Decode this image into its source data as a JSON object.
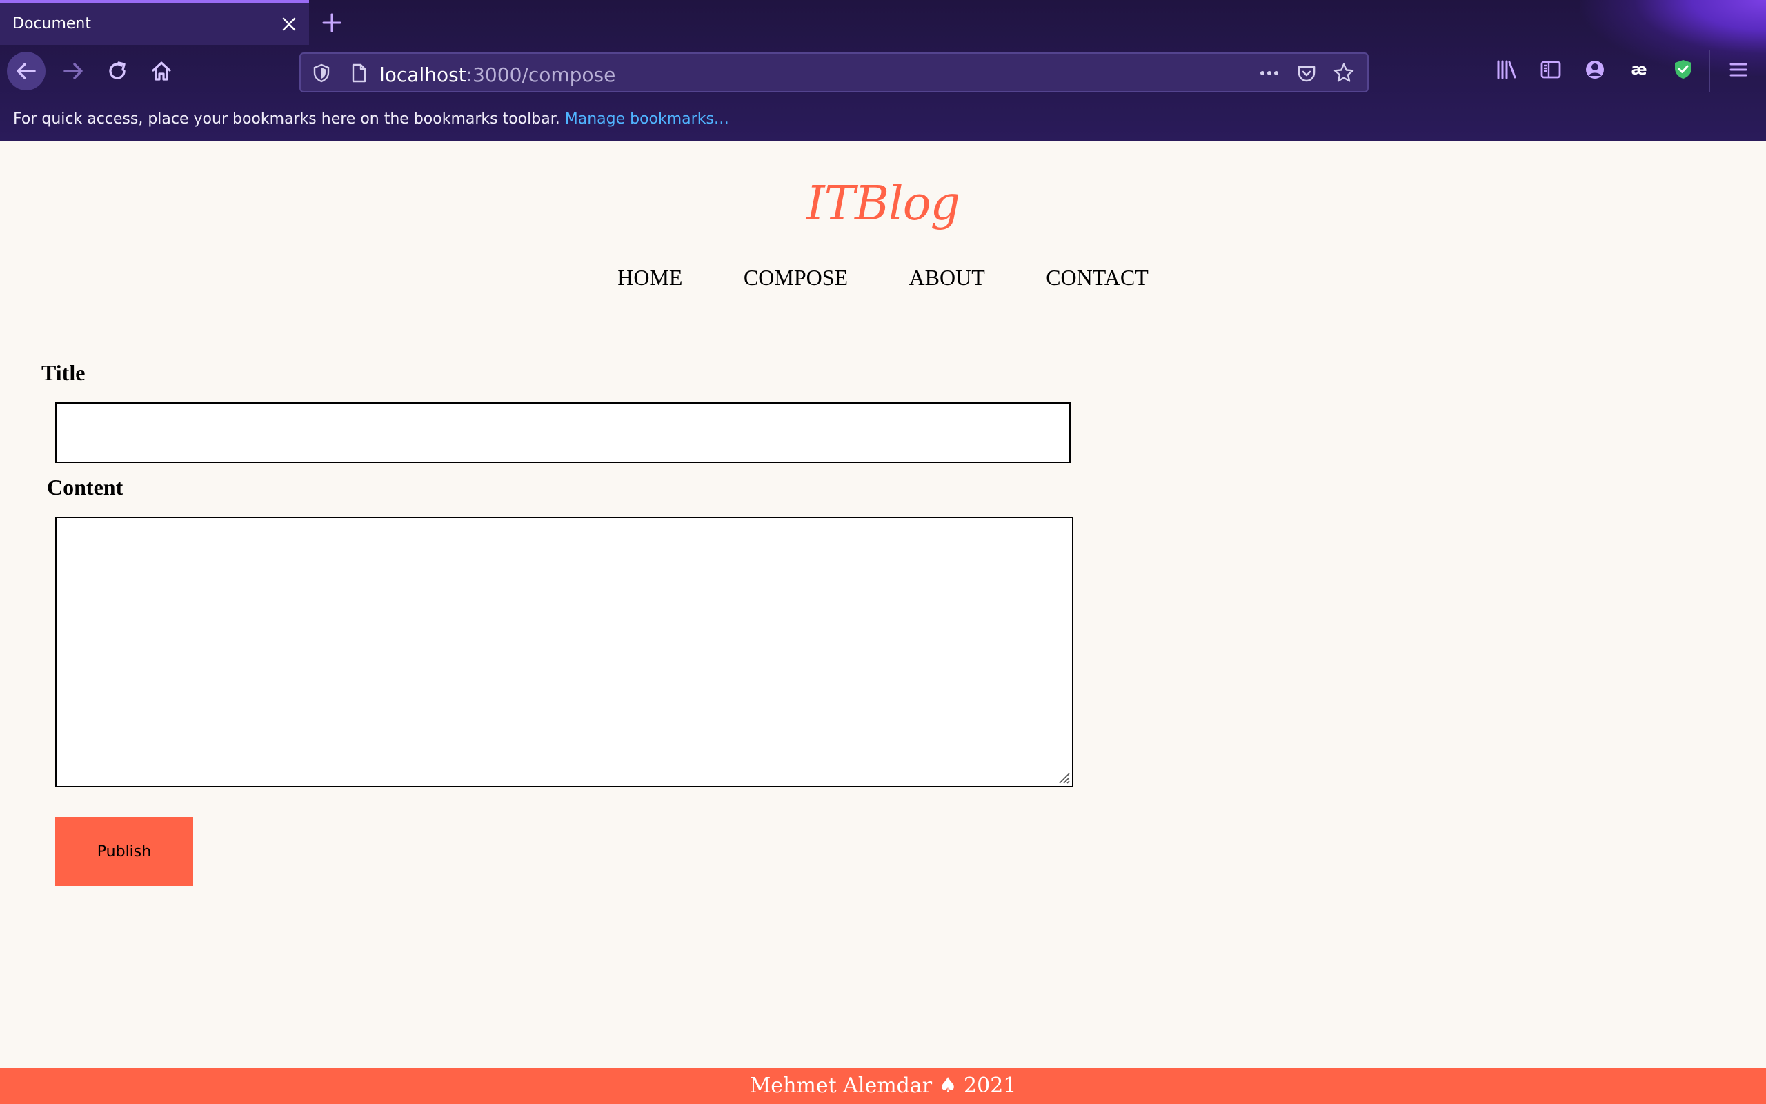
{
  "browser": {
    "tab_title": "Document",
    "url_host": "localhost",
    "url_path": ":3000/compose",
    "bookmarks_text": "For quick access, place your bookmarks here on the bookmarks toolbar.",
    "bookmarks_link": "Manage bookmarks…",
    "icons": [
      "close-icon",
      "plus-icon",
      "back-arrow-icon",
      "forward-arrow-icon",
      "reload-icon",
      "home-icon",
      "shield-icon",
      "page-icon",
      "more-icon",
      "pocket-icon",
      "star-icon",
      "library-icon",
      "sidebar-icon",
      "account-icon",
      "extension-icon",
      "vpn-shield-icon",
      "menu-icon"
    ]
  },
  "site": {
    "logo": "ITBlog",
    "nav": [
      "HOME",
      "COMPOSE",
      "ABOUT",
      "CONTACT"
    ],
    "accent_color": "#ff6347"
  },
  "form": {
    "title_label": "Title",
    "title_value": "",
    "content_label": "Content",
    "content_value": "",
    "publish_label": "Publish"
  },
  "footer": {
    "text": "Mehmet Alemdar ♠ 2021"
  }
}
